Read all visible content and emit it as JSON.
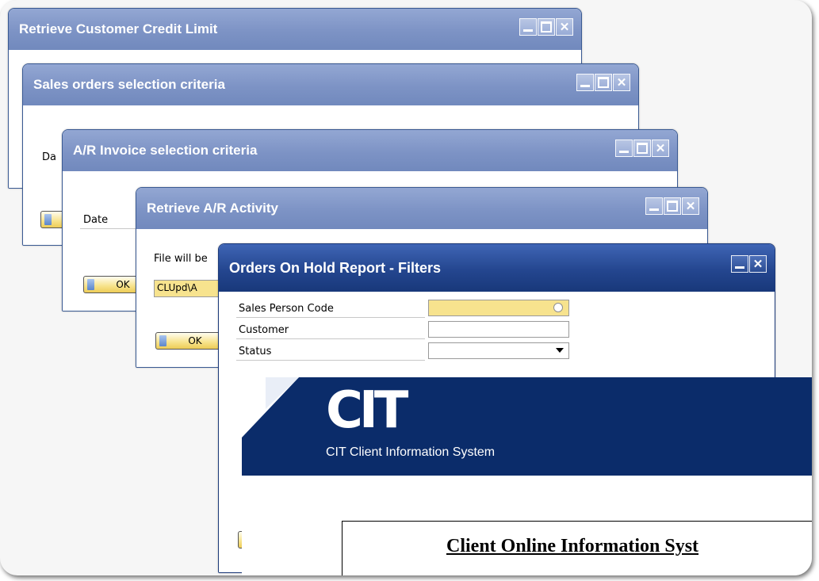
{
  "windows": {
    "credit": {
      "title": "Retrieve Customer Credit Limit"
    },
    "sales": {
      "title": "Sales orders selection criteria",
      "date_label_partial": "Da"
    },
    "invoice": {
      "title": "A/R Invoice selection criteria",
      "date_label": "Date",
      "ok_label": "OK"
    },
    "activity": {
      "title": "Retrieve A/R Activity",
      "file_label_partial": "File will be",
      "path_value_partial": "CLUpd\\A",
      "ok_label": "OK"
    },
    "filters": {
      "title": "Orders On Hold Report - Filters",
      "fields": [
        {
          "label": "Sales Person Code",
          "value": ""
        },
        {
          "label": "Customer",
          "value": ""
        },
        {
          "label": "Status",
          "value": ""
        }
      ]
    }
  },
  "cit": {
    "logo_text": "CIT",
    "subtitle": "CIT Client Information System",
    "heading_partial": "Client Online Information Syst"
  },
  "icons": {
    "minimize": "minimize-icon",
    "maximize": "maximize-icon",
    "close": "close-icon",
    "dropdown": "chevron-down-icon",
    "lookup": "lookup-icon"
  },
  "colors": {
    "inactive_titlebar": "#7d93c5",
    "active_titlebar": "#24468f",
    "ok_button": "#f7e28a",
    "cit_banner": "#0b2c6a"
  }
}
